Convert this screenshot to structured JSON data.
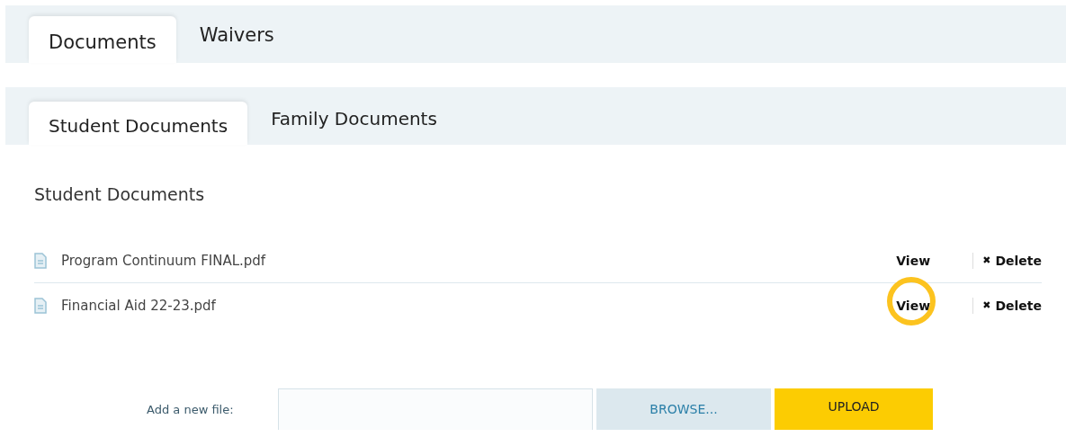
{
  "main_tabs": [
    {
      "label": "Documents",
      "selected": true
    },
    {
      "label": "Waivers",
      "selected": false
    }
  ],
  "sub_tabs": [
    {
      "label": "Student Documents",
      "selected": true
    },
    {
      "label": "Family Documents",
      "selected": false
    }
  ],
  "section_title": "Student Documents",
  "files": [
    {
      "name": "Program Continuum FINAL.pdf",
      "view": "View",
      "delete_icon": "✖",
      "delete": "Delete",
      "highlighted": false
    },
    {
      "name": "Financial Aid 22-23.pdf",
      "view": "View",
      "delete_icon": "✖",
      "delete": "Delete",
      "highlighted": true
    }
  ],
  "upload": {
    "label": "Add a new file:",
    "browse": "BROWSE...",
    "upload": "UPLOAD"
  }
}
